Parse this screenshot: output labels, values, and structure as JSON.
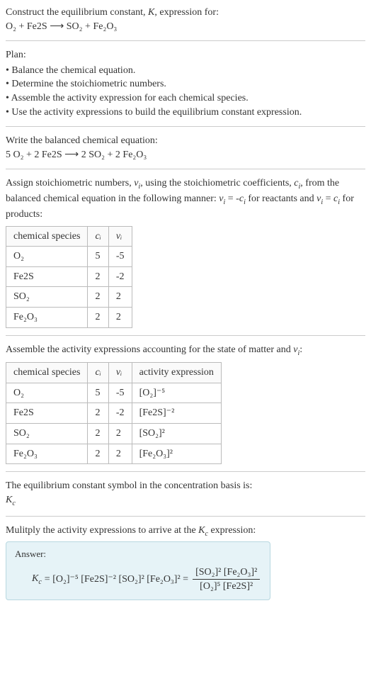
{
  "intro": {
    "line1": "Construct the equilibrium constant, ",
    "k": "K",
    "line1b": ", expression for:",
    "equation_lhs": "O₂ + Fe2S",
    "arrow": " ⟶ ",
    "equation_rhs": "SO₂ + Fe₂O₃"
  },
  "plan": {
    "title": "Plan:",
    "items": [
      "Balance the chemical equation.",
      "Determine the stoichiometric numbers.",
      "Assemble the activity expression for each chemical species.",
      "Use the activity expressions to build the equilibrium constant expression."
    ]
  },
  "balanced": {
    "title": "Write the balanced chemical equation:",
    "equation": "5 O₂ + 2 Fe2S ⟶ 2 SO₂ + 2 Fe₂O₃"
  },
  "stoich_intro": {
    "part1": "Assign stoichiometric numbers, ",
    "nu": "ν",
    "sub_i": "i",
    "part2": ", using the stoichiometric coefficients, ",
    "c": "c",
    "part3": ", from the balanced chemical equation in the following manner: ",
    "rel1_lhs": "ν",
    "rel1_eq": " = -",
    "rel1_rhs": "c",
    "part4": " for reactants and ",
    "rel2_eq": " = ",
    "part5": " for products:"
  },
  "table1": {
    "headers": [
      "chemical species",
      "cᵢ",
      "νᵢ"
    ],
    "rows": [
      [
        "O₂",
        "5",
        "-5"
      ],
      [
        "Fe2S",
        "2",
        "-2"
      ],
      [
        "SO₂",
        "2",
        "2"
      ],
      [
        "Fe₂O₃",
        "2",
        "2"
      ]
    ]
  },
  "activity_intro": {
    "text1": "Assemble the activity expressions accounting for the state of matter and ",
    "nu": "ν",
    "sub_i": "i",
    "text2": ":"
  },
  "table2": {
    "headers": [
      "chemical species",
      "cᵢ",
      "νᵢ",
      "activity expression"
    ],
    "rows": [
      [
        "O₂",
        "5",
        "-5",
        "[O₂]⁻⁵"
      ],
      [
        "Fe2S",
        "2",
        "-2",
        "[Fe2S]⁻²"
      ],
      [
        "SO₂",
        "2",
        "2",
        "[SO₂]²"
      ],
      [
        "Fe₂O₃",
        "2",
        "2",
        "[Fe₂O₃]²"
      ]
    ]
  },
  "eq_symbol": {
    "line1": "The equilibrium constant symbol in the concentration basis is:",
    "kc": "K",
    "kc_sub": "c"
  },
  "multiply": {
    "line1": "Mulitply the activity expressions to arrive at the ",
    "kc": "K",
    "kc_sub": "c",
    "line2": " expression:"
  },
  "answer": {
    "label": "Answer:",
    "kc": "K",
    "kc_sub": "c",
    "eq": " = [O₂]⁻⁵ [Fe2S]⁻² [SO₂]² [Fe₂O₃]² = ",
    "frac_num": "[SO₂]² [Fe₂O₃]²",
    "frac_den": "[O₂]⁵ [Fe2S]²"
  }
}
